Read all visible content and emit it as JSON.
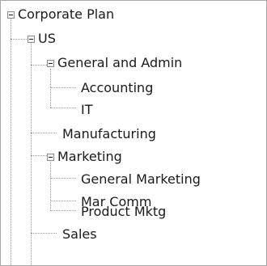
{
  "tree": {
    "items": [
      {
        "label": "Corporate Plan",
        "expanded": true,
        "depth": 0
      },
      {
        "label": "US",
        "expanded": true,
        "depth": 1
      },
      {
        "label": "General and Admin",
        "expanded": true,
        "depth": 2
      },
      {
        "label": "Accounting",
        "depth": 3
      },
      {
        "label": "IT",
        "depth": 3
      },
      {
        "label": "Manufacturing",
        "depth": 2
      },
      {
        "label": "Marketing",
        "expanded": true,
        "depth": 2
      },
      {
        "label": "General Marketing",
        "depth": 3
      },
      {
        "label": "Mar Comm",
        "depth": 3
      },
      {
        "label": "Product Mktg",
        "depth": 3
      },
      {
        "label": "Sales",
        "depth": 2
      }
    ]
  }
}
